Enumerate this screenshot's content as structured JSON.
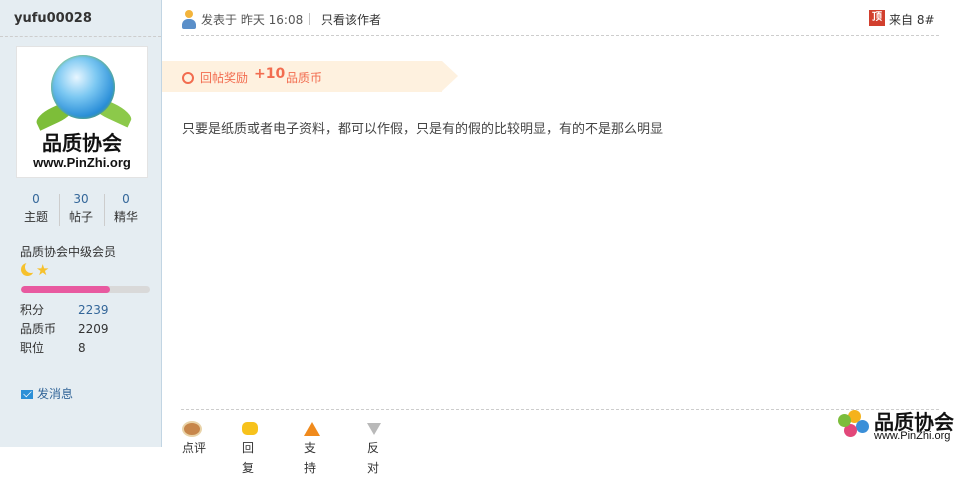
{
  "sidebar": {
    "username": "yufu00028",
    "avatar": {
      "title": "品质协会",
      "url": "www.PinZhi.org"
    },
    "stats": [
      {
        "value": "0",
        "label": "主题"
      },
      {
        "value": "30",
        "label": "帖子"
      },
      {
        "value": "0",
        "label": "精华"
      }
    ],
    "group": "品质协会中级会员",
    "level_icons": [
      "moon-icon",
      "star-icon"
    ],
    "level_progress_percent": 69,
    "info": [
      {
        "key": "积分",
        "value": "2239"
      },
      {
        "key": "品质币",
        "value": "2209"
      },
      {
        "key": "职位",
        "value": "8"
      }
    ],
    "send_message": "发消息"
  },
  "post": {
    "posted": "发表于 昨天 16:08",
    "only_author": "只看该作者",
    "top_badge": "顶",
    "floor": "来自 8#",
    "reward": {
      "label": "回帖奖励",
      "amount": "+10",
      "unit": "品质币"
    },
    "content": "只要是纸质或者电子资料，都可以作假，只是有的假的比较明显，有的不是那么明显"
  },
  "actions": {
    "comment": "点评",
    "reply": "回复",
    "support": "支持",
    "oppose": "反对"
  },
  "watermark": {
    "cn": "品质协会",
    "url": "www.PinZhi.org"
  },
  "colors": {
    "sidebar_bg": "#E5EDF2",
    "link": "#336699",
    "reward": "#F26C4F",
    "progress": "#E85AA0"
  }
}
